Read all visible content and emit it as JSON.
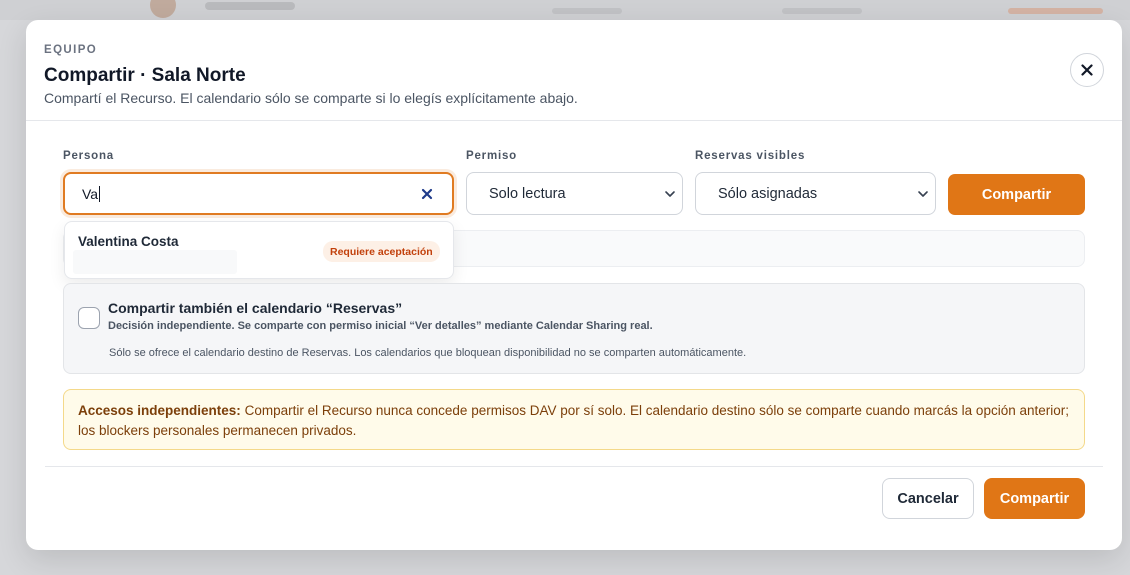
{
  "header": {
    "eyebrow": "EQUIPO",
    "title": "Compartir · Sala Norte",
    "subtitle": "Compartí el Recurso. El calendario sólo se comparte si lo elegís explícitamente abajo."
  },
  "form": {
    "person": {
      "label": "Persona",
      "value": "Va"
    },
    "permission": {
      "label": "Permiso",
      "selected": "Solo lectura"
    },
    "visible_bookings": {
      "label": "Reservas visibles",
      "selected": "Sólo asignadas"
    },
    "share_label": "Compartir"
  },
  "suggestion": {
    "name": "Valentina Costa",
    "badge": "Requiere aceptación"
  },
  "calendar_option": {
    "checked": false,
    "title": "Compartir también el calendario “Reservas”",
    "description": "Decisión independiente. Se comparte con permiso inicial “Ver detalles” mediante Calendar Sharing real.",
    "note": "Sólo se ofrece el calendario destino de Reservas. Los calendarios que bloquean disponibilidad no se comparten automáticamente."
  },
  "notice": {
    "heading": "Accesos independientes:",
    "text": "Compartir el Recurso nunca concede permisos DAV por sí solo. El calendario destino sólo se comparte cuando marcás la opción anterior; los blockers personales permanecen privados."
  },
  "footer": {
    "cancel_label": "Cancelar",
    "share_label": "Compartir"
  },
  "colors": {
    "accent": "#e07616",
    "warning_bg": "#fffbea",
    "warning_text": "#7c3f0a",
    "badge_text": "#c2410c"
  },
  "icons": {
    "close": "close-icon",
    "clear": "clear-icon",
    "chevron": "chevron-down-icon"
  }
}
